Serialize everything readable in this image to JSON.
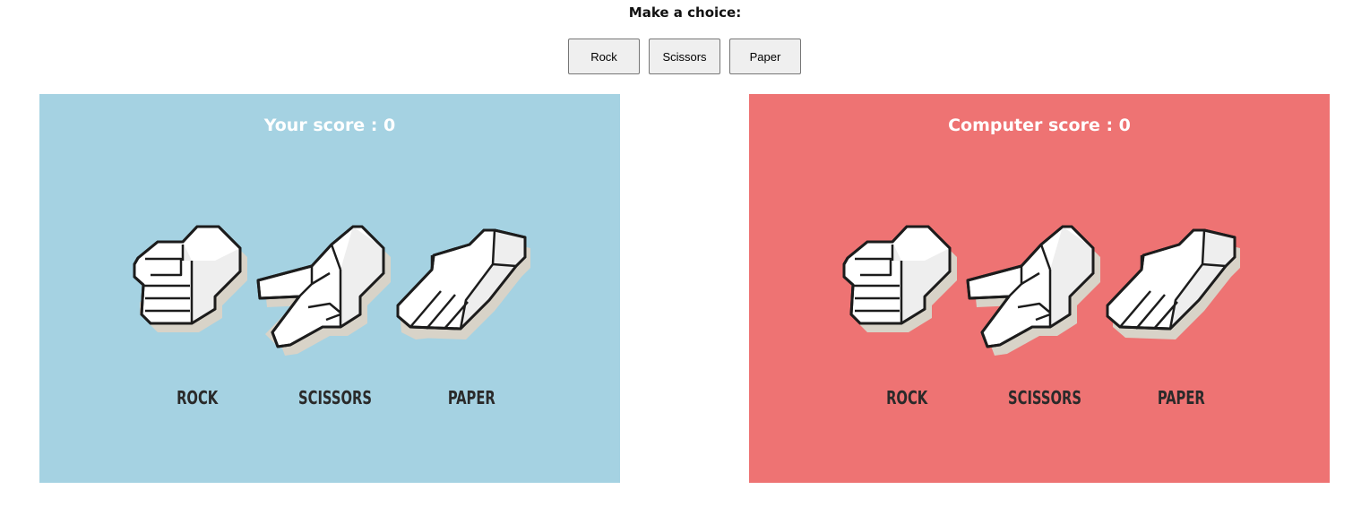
{
  "prompt": "Make a choice:",
  "buttons": {
    "rock": "Rock",
    "scissors": "Scissors",
    "paper": "Paper"
  },
  "player": {
    "title": "Your score : 0",
    "color": "#a5d2e2",
    "labels": {
      "rock": "ROCK",
      "scissors": "SCISSORS",
      "paper": "PAPER"
    }
  },
  "computer": {
    "title": "Computer score : 0",
    "color": "#ee7373",
    "labels": {
      "rock": "ROCK",
      "scissors": "SCISSORS",
      "paper": "PAPER"
    }
  },
  "colors": {
    "hand_fill": "#ffffff",
    "hand_shade": "#eeeeee",
    "hand_shadow": "#d8d3c8",
    "outline": "#1c1c1c",
    "label": "#2a2a2a"
  }
}
